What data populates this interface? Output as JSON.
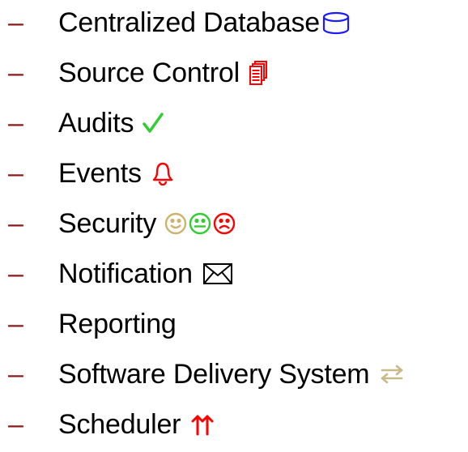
{
  "bullet": "–",
  "items": [
    {
      "label": "Centralized Database",
      "icon": "database-icon"
    },
    {
      "label": "Source Control",
      "icon": "documents-icon"
    },
    {
      "label": "Audits",
      "icon": "checkmark-icon",
      "glyph": "✓"
    },
    {
      "label": "Events",
      "icon": "bell-icon"
    },
    {
      "label": "Security",
      "icon": "faces-icon",
      "glyph": "☺☺☹"
    },
    {
      "label": "Notification",
      "icon": "envelope-icon"
    },
    {
      "label": "Reporting",
      "icon": ""
    },
    {
      "label": "Software Delivery System",
      "icon": "arrows-icon",
      "glyph": "⇆"
    },
    {
      "label": "Scheduler",
      "icon": "double-up-arrow-icon",
      "glyph": "⇈"
    }
  ],
  "colors": {
    "bullet": "#8b1a1a",
    "database": "#1a1aff",
    "documents": "#ff0000",
    "check": "#33cc33",
    "bell": "#ff0000",
    "face_happy": "#cdb36c",
    "face_neutral": "#33cc33",
    "face_sad": "#ff0000",
    "envelope": "#000000",
    "arrows": "#c8b98a",
    "scheduler": "#ff0000"
  }
}
